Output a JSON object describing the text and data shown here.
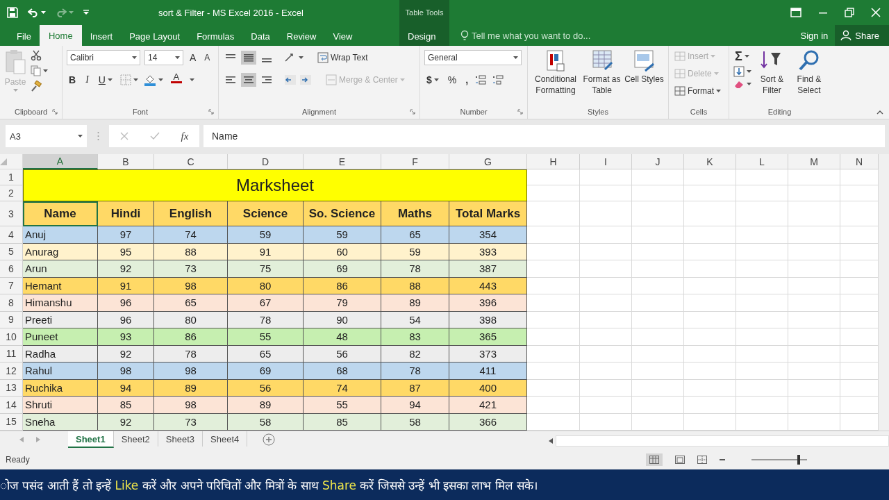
{
  "window": {
    "title": "sort & Filter - MS Excel 2016 - Excel",
    "context_group": "Table Tools"
  },
  "tabs": [
    {
      "label": "File",
      "selected": false
    },
    {
      "label": "Home",
      "selected": true
    },
    {
      "label": "Insert",
      "selected": false
    },
    {
      "label": "Page Layout",
      "selected": false
    },
    {
      "label": "Formulas",
      "selected": false
    },
    {
      "label": "Data",
      "selected": false
    },
    {
      "label": "Review",
      "selected": false
    },
    {
      "label": "View",
      "selected": false
    },
    {
      "label": "Design",
      "selected": false,
      "kind": "context"
    }
  ],
  "tell_me": {
    "placeholder": "Tell me what you want to do..."
  },
  "account": {
    "sign_in": "Sign in",
    "share": "Share"
  },
  "ribbon": {
    "clipboard": {
      "label": "Clipboard",
      "paste": "Paste"
    },
    "font": {
      "label": "Font",
      "font_name": "Calibri",
      "font_size": "14",
      "grow": "A",
      "shrink": "A",
      "styles": [
        "B",
        "I",
        "U"
      ],
      "font_color": "A"
    },
    "alignment": {
      "label": "Alignment",
      "wrap_text": "Wrap Text",
      "merge_center": "Merge & Center"
    },
    "number": {
      "label": "Number",
      "format": "General",
      "currency": "$",
      "percent": "%",
      "comma": ","
    },
    "styles": {
      "label": "Styles",
      "buttons": [
        "Conditional Formatting",
        "Format as Table",
        "Cell Styles"
      ]
    },
    "cells": {
      "label": "Cells",
      "buttons": [
        {
          "label": "Insert",
          "disabled": true
        },
        {
          "label": "Delete",
          "disabled": true
        },
        {
          "label": "Format",
          "disabled": false
        }
      ]
    },
    "editing": {
      "label": "Editing",
      "autosum": "Σ",
      "buttons": [
        "Sort & Filter",
        "Find & Select"
      ]
    }
  },
  "formula_bar": {
    "name_box": "A3",
    "function_label": "fx",
    "value": "Name"
  },
  "sheet": {
    "columns": [
      {
        "label": "A",
        "selected": true
      },
      {
        "label": "B",
        "selected": false
      },
      {
        "label": "C",
        "selected": false
      },
      {
        "label": "D",
        "selected": false
      },
      {
        "label": "E",
        "selected": false
      },
      {
        "label": "F",
        "selected": false
      },
      {
        "label": "G",
        "selected": false
      },
      {
        "label": "H",
        "selected": false
      },
      {
        "label": "I",
        "selected": false
      },
      {
        "label": "J",
        "selected": false
      },
      {
        "label": "K",
        "selected": false
      },
      {
        "label": "L",
        "selected": false
      },
      {
        "label": "M",
        "selected": false
      },
      {
        "label": "N",
        "selected": false
      }
    ],
    "row_numbers": [
      "1",
      "2",
      "3",
      "4",
      "5",
      "6",
      "7",
      "8",
      "9",
      "10",
      "11",
      "12",
      "13",
      "14",
      "15"
    ],
    "title": "Marksheet",
    "headers": [
      {
        "text": "Name",
        "selected": true
      },
      {
        "text": "Hindi",
        "selected": false
      },
      {
        "text": "English",
        "selected": false
      },
      {
        "text": "Science",
        "selected": false
      },
      {
        "text": "So. Science",
        "selected": false
      },
      {
        "text": "Maths",
        "selected": false
      },
      {
        "text": "Total Marks",
        "selected": false
      }
    ],
    "rows": [
      {
        "color": "#bdd7ee",
        "cells": [
          "Anuj",
          "97",
          "74",
          "59",
          "59",
          "65",
          "354"
        ]
      },
      {
        "color": "#fff2cc",
        "cells": [
          "Anurag",
          "95",
          "88",
          "91",
          "60",
          "59",
          "393"
        ]
      },
      {
        "color": "#e2efda",
        "cells": [
          "Arun",
          "92",
          "73",
          "75",
          "69",
          "78",
          "387"
        ]
      },
      {
        "color": "#ffd966",
        "cells": [
          "Hemant",
          "91",
          "98",
          "80",
          "86",
          "88",
          "443"
        ]
      },
      {
        "color": "#fce4d6",
        "cells": [
          "Himanshu",
          "96",
          "65",
          "67",
          "79",
          "89",
          "396"
        ]
      },
      {
        "color": "#ededed",
        "cells": [
          "Preeti",
          "96",
          "80",
          "78",
          "90",
          "54",
          "398"
        ]
      },
      {
        "color": "#c6efb0",
        "cells": [
          "Puneet",
          "93",
          "86",
          "55",
          "48",
          "83",
          "365"
        ]
      },
      {
        "color": "#ededed",
        "cells": [
          "Radha",
          "92",
          "78",
          "65",
          "56",
          "82",
          "373"
        ]
      },
      {
        "color": "#bdd7ee",
        "cells": [
          "Rahul",
          "98",
          "98",
          "69",
          "68",
          "78",
          "411"
        ]
      },
      {
        "color": "#ffd966",
        "cells": [
          "Ruchika",
          "94",
          "89",
          "56",
          "74",
          "87",
          "400"
        ]
      },
      {
        "color": "#fce4d6",
        "cells": [
          "Shruti",
          "85",
          "98",
          "89",
          "55",
          "94",
          "421"
        ]
      },
      {
        "color": "#e2efda",
        "cells": [
          "Sneha",
          "92",
          "73",
          "58",
          "85",
          "58",
          "366"
        ]
      }
    ]
  },
  "sheet_tabs": [
    {
      "label": "Sheet1",
      "selected": true
    },
    {
      "label": "Sheet2",
      "selected": false
    },
    {
      "label": "Sheet3",
      "selected": false
    },
    {
      "label": "Sheet4",
      "selected": false
    }
  ],
  "status_bar": {
    "status": "Ready",
    "zoom": {
      "level": 0.85
    }
  },
  "ticker": [
    {
      "text": "ोज पसंद आती हैं तो इन्हें ",
      "highlight": false
    },
    {
      "text": "Like",
      "highlight": true
    },
    {
      "text": " करें और अपने परिचितों और मित्रों के साथ ",
      "highlight": false
    },
    {
      "text": "Share",
      "highlight": true
    },
    {
      "text": " करें जिससे उन्हें भी इसका लाभ मिल सके।",
      "highlight": false
    }
  ]
}
